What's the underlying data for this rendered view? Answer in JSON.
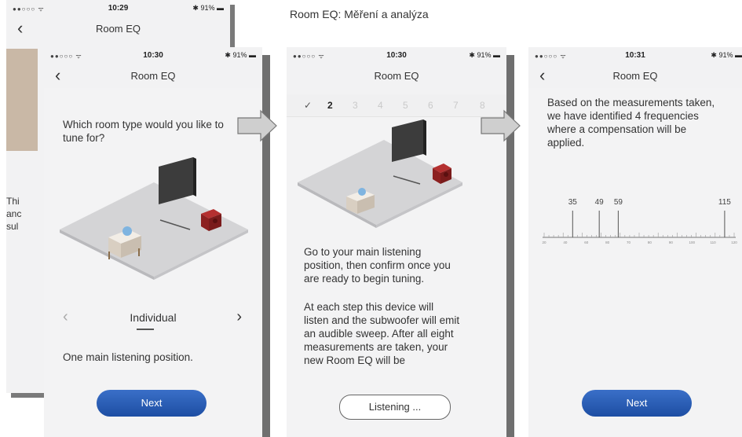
{
  "caption": "Room EQ: Měření a analýza",
  "back_phone": {
    "time": "10:29",
    "battery": "91%",
    "title": "Room EQ",
    "partial_text": [
      "Thi",
      "anc",
      "sul"
    ]
  },
  "phone1": {
    "time": "10:30",
    "battery": "91%",
    "title": "Room EQ",
    "question": "Which room type would you like to tune for?",
    "selector_label": "Individual",
    "description": "One main listening position.",
    "next_label": "Next"
  },
  "phone2": {
    "time": "10:30",
    "battery": "91%",
    "title": "Room EQ",
    "steps": [
      "✓",
      "2",
      "3",
      "4",
      "5",
      "6",
      "7",
      "8"
    ],
    "instruction1": "Go to your main listening position, then confirm once you are ready to begin tuning.",
    "instruction2": "At each step this device will listen and the subwoofer will emit an audible sweep. After all eight measurements are taken, your new Room EQ will be",
    "listening_label": "Listening ..."
  },
  "phone3": {
    "time": "10:31",
    "battery": "91%",
    "title": "Room EQ",
    "result_text": "Based on the measurements taken, we have identified 4 frequencies where a compensation will be applied.",
    "next_label": "Next"
  },
  "chart_data": {
    "type": "scatter",
    "title": "",
    "xlabel": "",
    "ylabel": "",
    "frequencies": [
      35,
      49,
      59,
      115
    ],
    "x": [
      35,
      49,
      59,
      115
    ],
    "xlim": [
      20,
      120
    ],
    "axis_ticks": [
      "20",
      "40",
      "60",
      "80",
      "70",
      "80",
      "90",
      "100",
      "110",
      "120"
    ]
  },
  "colors": {
    "button": "#2a5bb5",
    "background": "#f2f2f3",
    "subwoofer": "#8c2020"
  },
  "icons": {
    "back": "chevron-left-icon",
    "arrow": "right-arrow-icon"
  }
}
